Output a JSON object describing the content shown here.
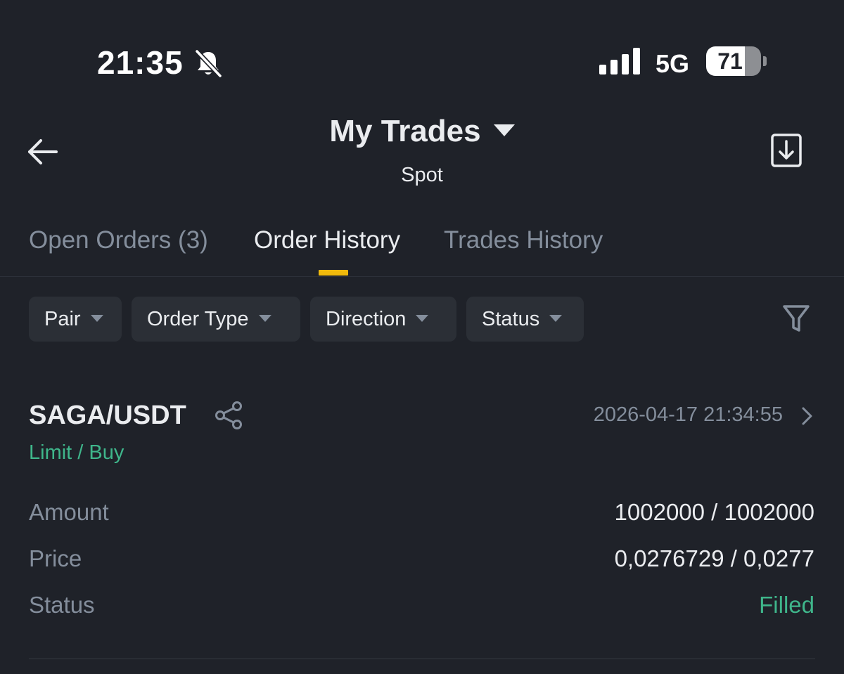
{
  "status_bar": {
    "time": "21:35",
    "network": "5G",
    "battery_level": "71",
    "battery_fraction": 0.71,
    "icons": [
      "bell-muted-icon",
      "signal-bars-icon",
      "battery-icon"
    ]
  },
  "header": {
    "title": "My Trades",
    "subtitle": "Spot",
    "icons": [
      "back-arrow-icon",
      "caret-down-icon",
      "download-icon"
    ]
  },
  "tabs": [
    {
      "label": "Open Orders (3)",
      "active": false
    },
    {
      "label": "Order History",
      "active": true
    },
    {
      "label": "Trades History",
      "active": false
    }
  ],
  "filters": [
    {
      "label": "Pair"
    },
    {
      "label": "Order Type"
    },
    {
      "label": "Direction"
    },
    {
      "label": "Status"
    }
  ],
  "filter_icon": "funnel-icon",
  "order": {
    "pair": "SAGA/USDT",
    "datetime": "2026-04-17 21:34:55",
    "type": "Limit / Buy",
    "rows": [
      {
        "label": "Amount",
        "value": "1002000 / 1002000"
      },
      {
        "label": "Price",
        "value": "0,0276729 / 0,0277"
      },
      {
        "label": "Status",
        "value": "Filled"
      }
    ]
  },
  "colors": {
    "background": "#1f2229",
    "chip_background": "#2b2f36",
    "primary_text": "#eaecef",
    "secondary_text": "#848e9c",
    "accent_yellow": "#f0b90b",
    "buy_green": "#3fb68b"
  }
}
